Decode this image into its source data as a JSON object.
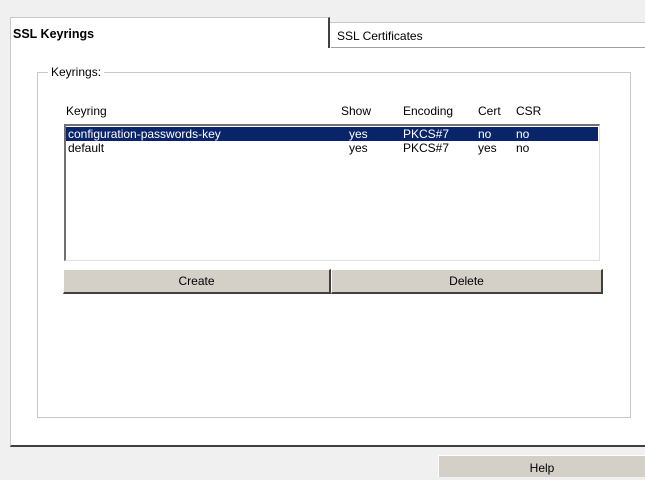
{
  "tabs": [
    {
      "label": "SSL Keyrings",
      "active": true
    },
    {
      "label": "SSL Certificates",
      "active": false
    }
  ],
  "keyrings_group": {
    "label": "Keyrings:"
  },
  "table": {
    "columns": [
      "Keyring",
      "Show",
      "Encoding",
      "Cert",
      "CSR"
    ],
    "rows": [
      [
        "configuration-passwords-key",
        "yes",
        "PKCS#7",
        "no",
        "no"
      ],
      [
        "default",
        "yes",
        "PKCS#7",
        "yes",
        "no"
      ]
    ],
    "selected_row": 0
  },
  "buttons": {
    "create": "Create",
    "delete": "Delete",
    "help": "Help"
  },
  "colors": {
    "selection": "#0a246a",
    "button_face": "#d4d0c8",
    "panel": "#ffffff",
    "background": "#f0f0f0"
  }
}
